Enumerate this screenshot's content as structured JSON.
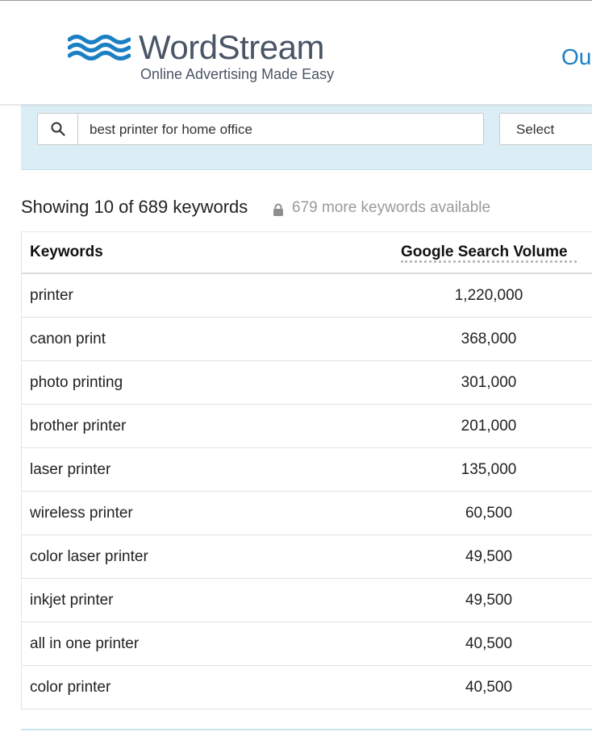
{
  "header": {
    "logo_name": "WordStream",
    "logo_tagline": "Online Advertising Made Easy",
    "nav_partial": "Ou",
    "brand_blue": "#1b7fc3",
    "logo_gray": "#4a5565"
  },
  "search": {
    "query": "best printer for home office",
    "select_label": "Select",
    "panel_color": "#dbeef6"
  },
  "summary": {
    "count_text": "Showing 10 of 689 keywords",
    "more_text": "679 more keywords available"
  },
  "table": {
    "columns": [
      "Keywords",
      "Google Search Volume"
    ],
    "rows": [
      {
        "keyword": "printer",
        "volume": "1,220,000"
      },
      {
        "keyword": "canon print",
        "volume": "368,000"
      },
      {
        "keyword": "photo printing",
        "volume": "301,000"
      },
      {
        "keyword": "brother printer",
        "volume": "201,000"
      },
      {
        "keyword": "laser printer",
        "volume": "135,000"
      },
      {
        "keyword": "wireless printer",
        "volume": "60,500"
      },
      {
        "keyword": "color laser printer",
        "volume": "49,500"
      },
      {
        "keyword": "inkjet printer",
        "volume": "49,500"
      },
      {
        "keyword": "all in one printer",
        "volume": "40,500"
      },
      {
        "keyword": "color printer",
        "volume": "40,500"
      }
    ]
  }
}
